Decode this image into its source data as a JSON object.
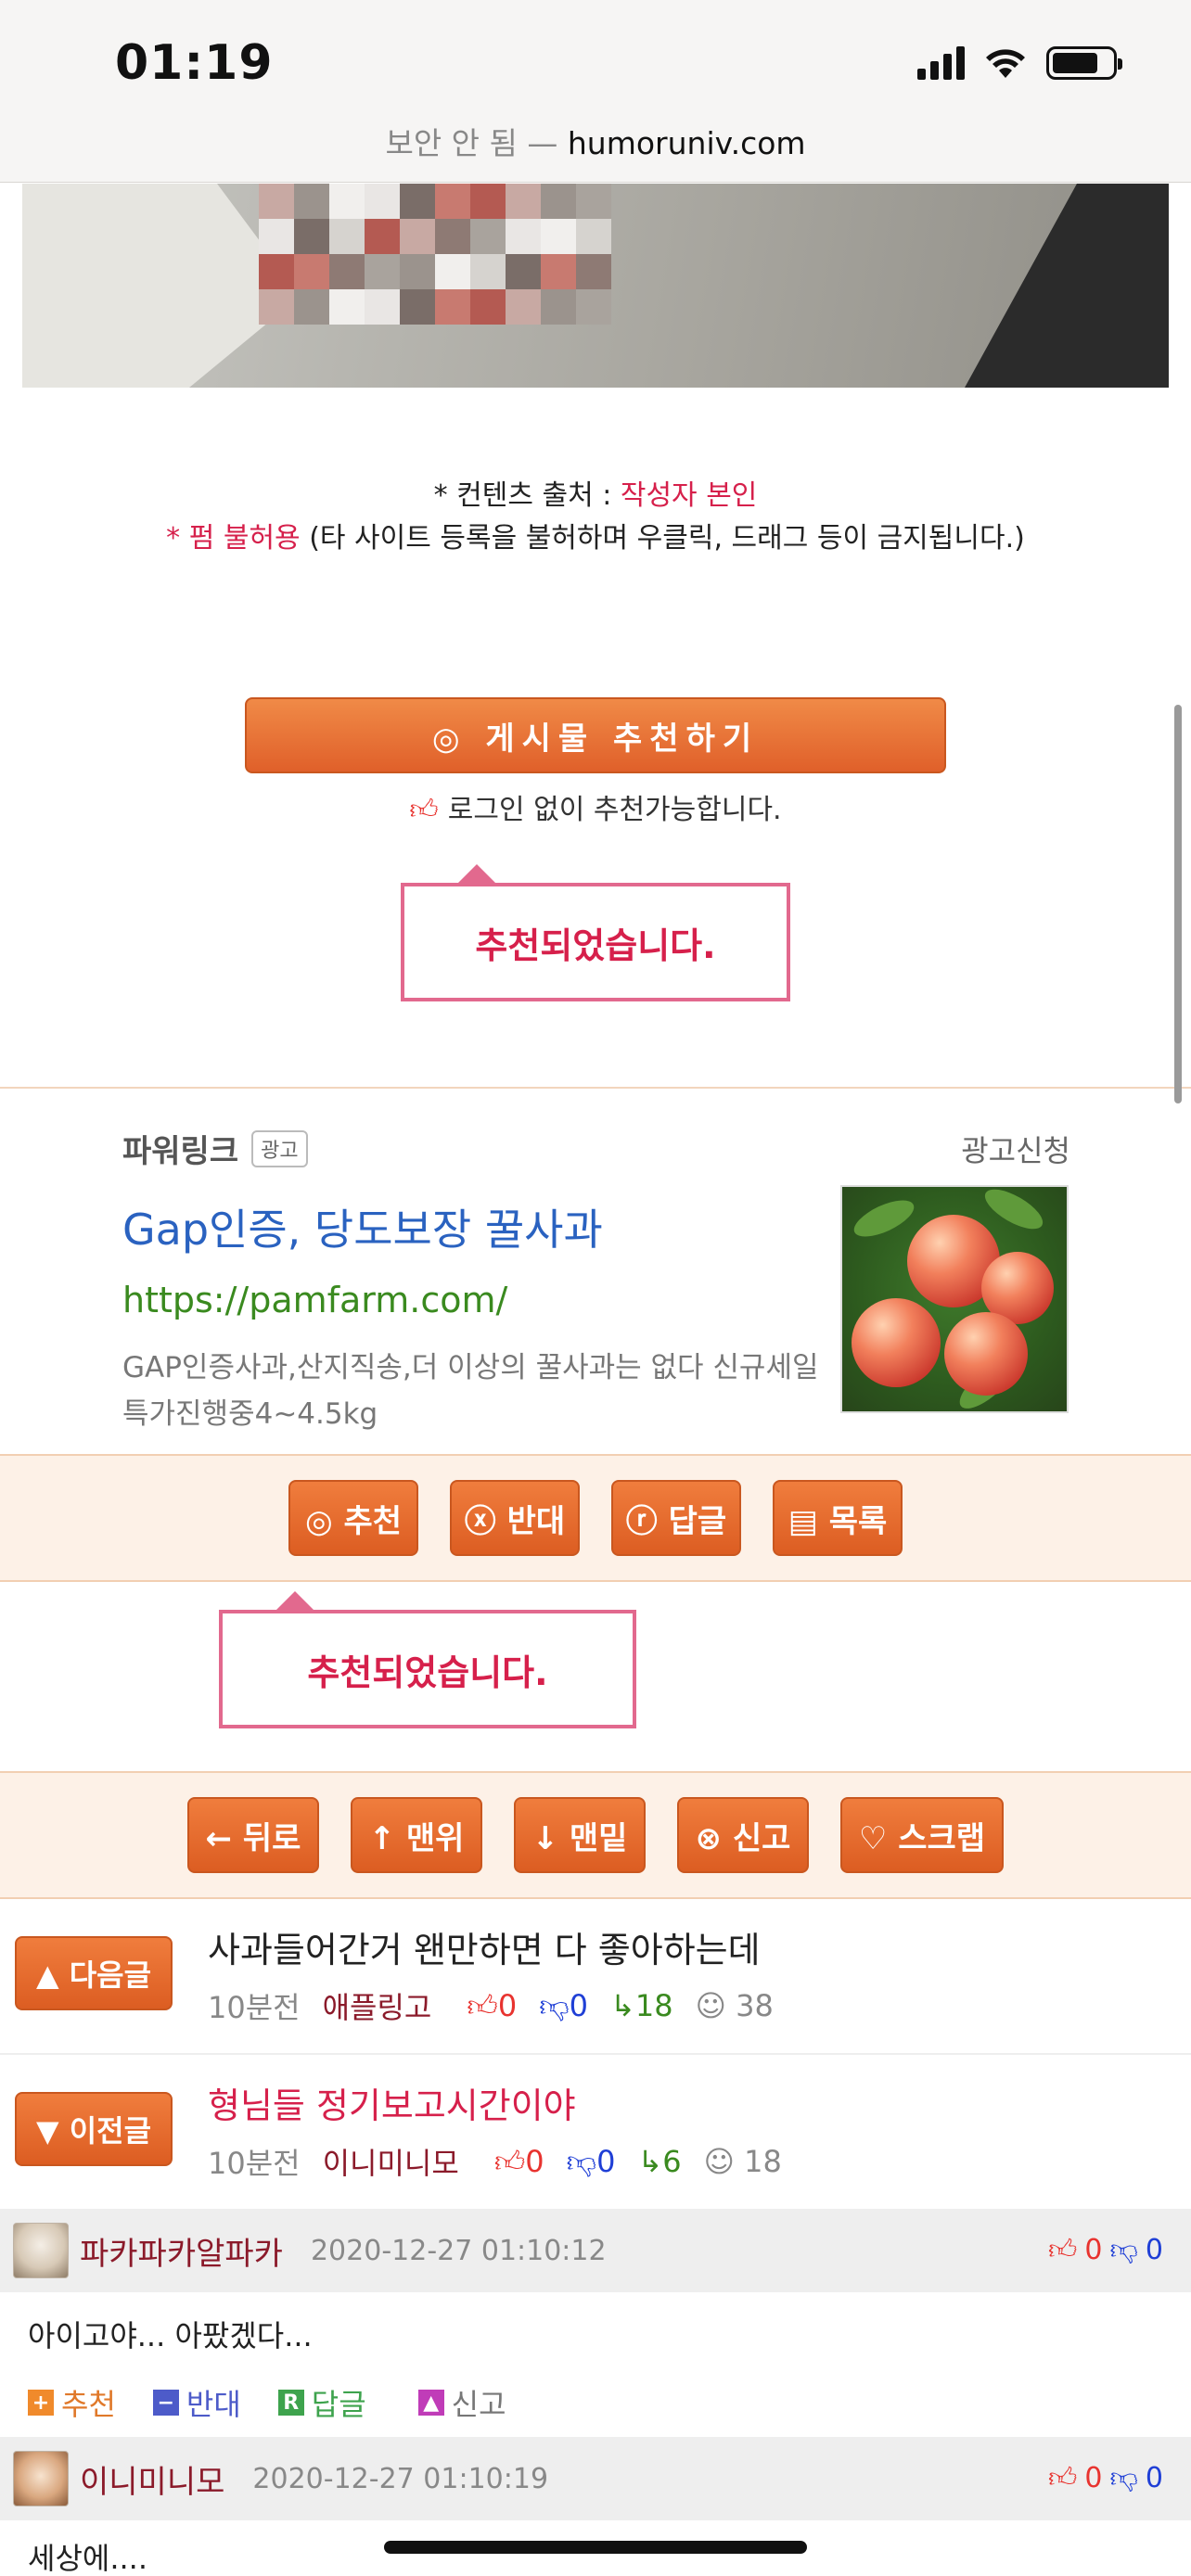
{
  "status": {
    "time": "01:19"
  },
  "browser": {
    "security": "보안 안 됨 —",
    "host": "humoruniv.com"
  },
  "notes": {
    "line1_prefix": "* 컨텐츠 출처 : ",
    "line1_value": "작성자 본인",
    "line2_prefix": "* ",
    "line2_value": "펌 불허용",
    "line2_suffix": " (타 사이트 등록을 불허하며 우클릭, 드래그 등이 금지됩니다.)"
  },
  "recommend": {
    "button": "◎ 게시물 추천하기",
    "notice": "로그인 없이 추천가능합니다.",
    "tooltip": "추천되었습니다."
  },
  "ad": {
    "label": "파워링크",
    "badge": "광고",
    "apply": "광고신청",
    "title": "Gap인증, 당도보장 꿀사과",
    "url": "https://pamfarm.com/",
    "desc": "GAP인증사과,산지직송,더 이상의 꿀사과는 없다 신규세일 특가진행중4~4.5kg"
  },
  "actions": {
    "recommend": "◎ 추천",
    "oppose": "ⓧ 반대",
    "reply": "ⓡ 답글",
    "list": "▤ 목록",
    "tooltip": "추천되었습니다."
  },
  "nav": {
    "back": "← 뒤로",
    "top": "↑ 맨위",
    "bottom": "↓ 맨밑",
    "report": "⊗ 신고",
    "scrap": "♡ 스크랩"
  },
  "next_post": {
    "tag": "▲ 다음글",
    "title": "사과들어간거 왠만하면 다 좋아하는데",
    "time": "10분전",
    "author": "애플링고",
    "up": "0",
    "down": "0",
    "replies": "18",
    "views": "38"
  },
  "prev_post": {
    "tag": "▼ 이전글",
    "title": "형님들 정기보고시간이야",
    "time": "10분전",
    "author": "이니미니모",
    "up": "0",
    "down": "0",
    "replies": "6",
    "views": "18"
  },
  "comments": [
    {
      "name": "파카파카알파카",
      "date": "2020-12-27 01:10:12",
      "up": "0",
      "down": "0",
      "body": "아이고야... 아팠겠다...",
      "actions": {
        "recommend": "추천",
        "oppose": "반대",
        "reply": "답글",
        "report": "신고"
      }
    },
    {
      "name": "이니미니모",
      "date": "2020-12-27 01:10:19",
      "up": "0",
      "down": "0",
      "body": "세상에...."
    }
  ],
  "colors": {
    "accent_orange": "#e0602a",
    "alert_pink": "#d6204b",
    "link_blue": "#2a62c0",
    "url_green": "#3a8a1f"
  }
}
